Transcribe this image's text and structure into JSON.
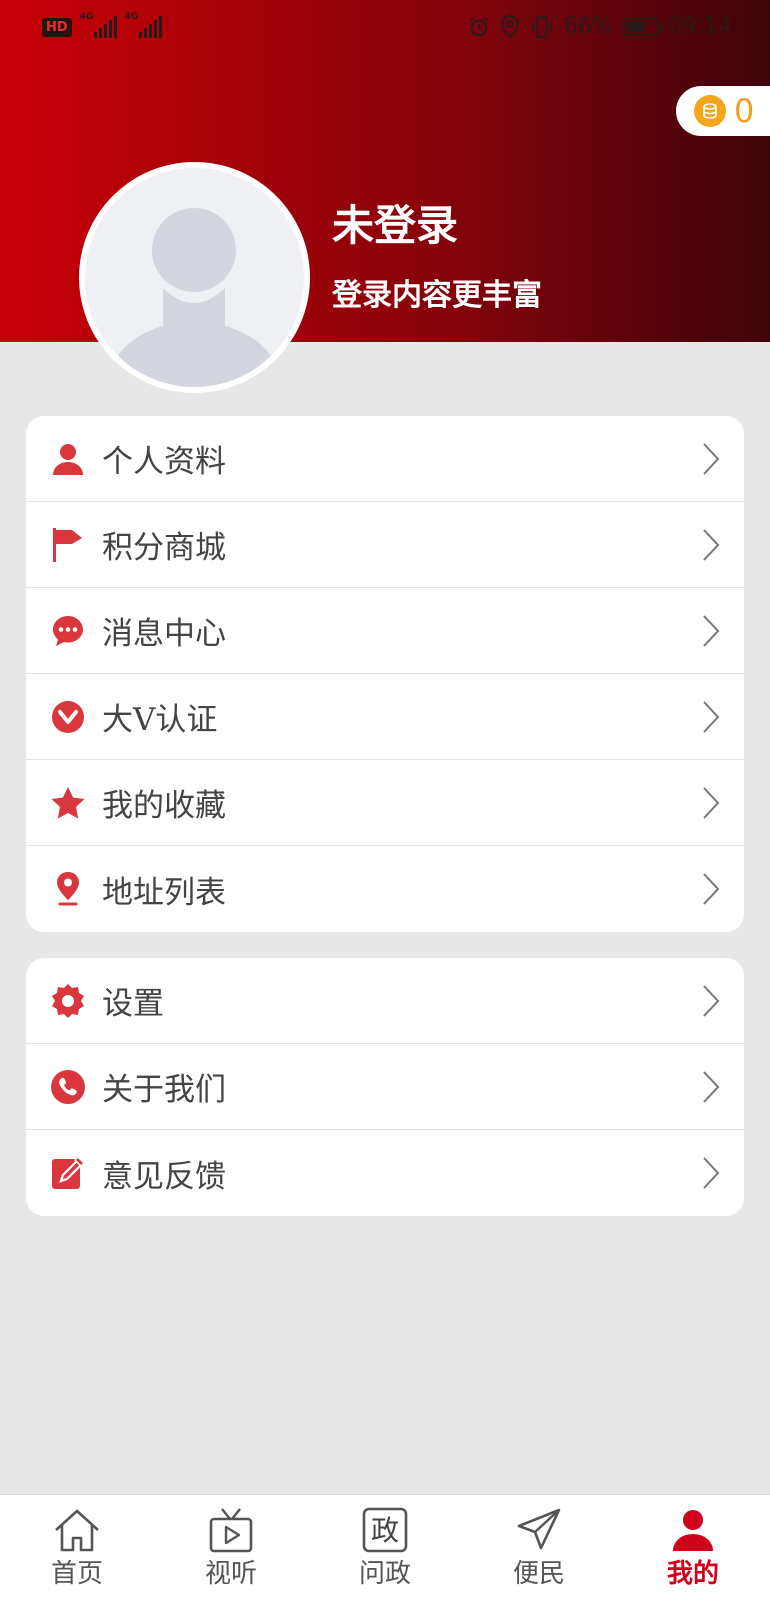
{
  "status_bar": {
    "hd": "HD",
    "net1": "4G",
    "net2": "4G",
    "battery_percent": "66%",
    "battery_level": 0.66,
    "time": "09:14"
  },
  "coins": {
    "count": "0",
    "icon": "coin-icon"
  },
  "profile": {
    "name": "未登录",
    "subtitle": "登录内容更丰富"
  },
  "menu_group_1": [
    {
      "label": "个人资料",
      "icon": "person-icon"
    },
    {
      "label": "积分商城",
      "icon": "flag-icon"
    },
    {
      "label": "消息中心",
      "icon": "chat-icon"
    },
    {
      "label": "大V认证",
      "icon": "v-badge-icon"
    },
    {
      "label": "我的收藏",
      "icon": "star-icon"
    },
    {
      "label": "地址列表",
      "icon": "location-pin-icon"
    }
  ],
  "menu_group_2": [
    {
      "label": "设置",
      "icon": "gear-icon"
    },
    {
      "label": "关于我们",
      "icon": "phone-icon"
    },
    {
      "label": "意见反馈",
      "icon": "edit-icon"
    }
  ],
  "tabbar": [
    {
      "label": "首页",
      "icon": "home-icon",
      "active": false
    },
    {
      "label": "视听",
      "icon": "tv-icon",
      "active": false
    },
    {
      "label": "问政",
      "icon": "zheng-icon",
      "glyph": "政",
      "active": false
    },
    {
      "label": "便民",
      "icon": "send-icon",
      "active": false
    },
    {
      "label": "我的",
      "icon": "user-icon",
      "active": true
    }
  ],
  "colors": {
    "accent": "#d0021b",
    "icon_red": "#d9363e",
    "header_start": "#c80008",
    "header_end": "#3e040a",
    "coin": "#f3a51c"
  }
}
